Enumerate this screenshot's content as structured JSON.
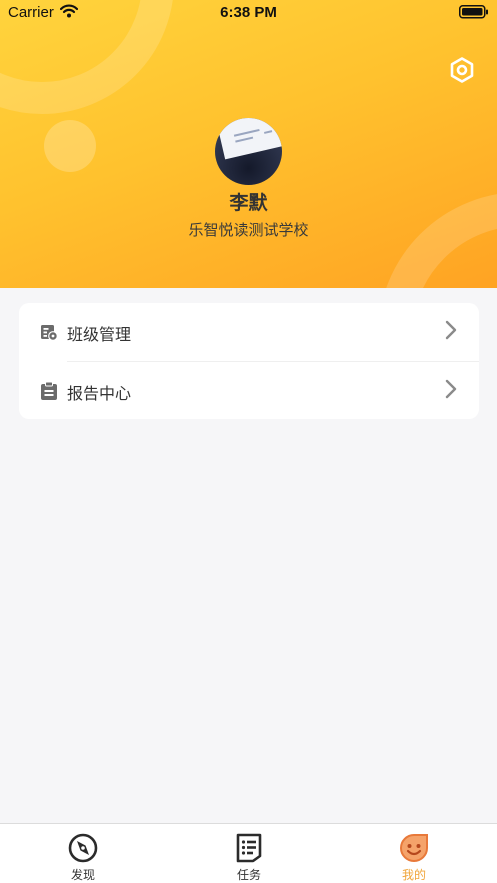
{
  "status_bar": {
    "carrier": "Carrier",
    "time": "6:38 PM"
  },
  "header": {
    "settings_icon": "settings-icon",
    "user_name": "李默",
    "school": "乐智悦读测试学校",
    "gradient_colors": [
      "#ffd43d",
      "#ffa323"
    ]
  },
  "menu": {
    "items": [
      {
        "label": "班级管理",
        "icon": "class-management-icon"
      },
      {
        "label": "报告中心",
        "icon": "clipboard-icon"
      }
    ]
  },
  "tab_bar": {
    "active_color": "#f0a53a",
    "tabs": [
      {
        "label": "发现",
        "icon": "compass-icon",
        "active": false
      },
      {
        "label": "任务",
        "icon": "task-list-icon",
        "active": false
      },
      {
        "label": "我的",
        "icon": "smiley-icon",
        "active": true
      }
    ]
  }
}
